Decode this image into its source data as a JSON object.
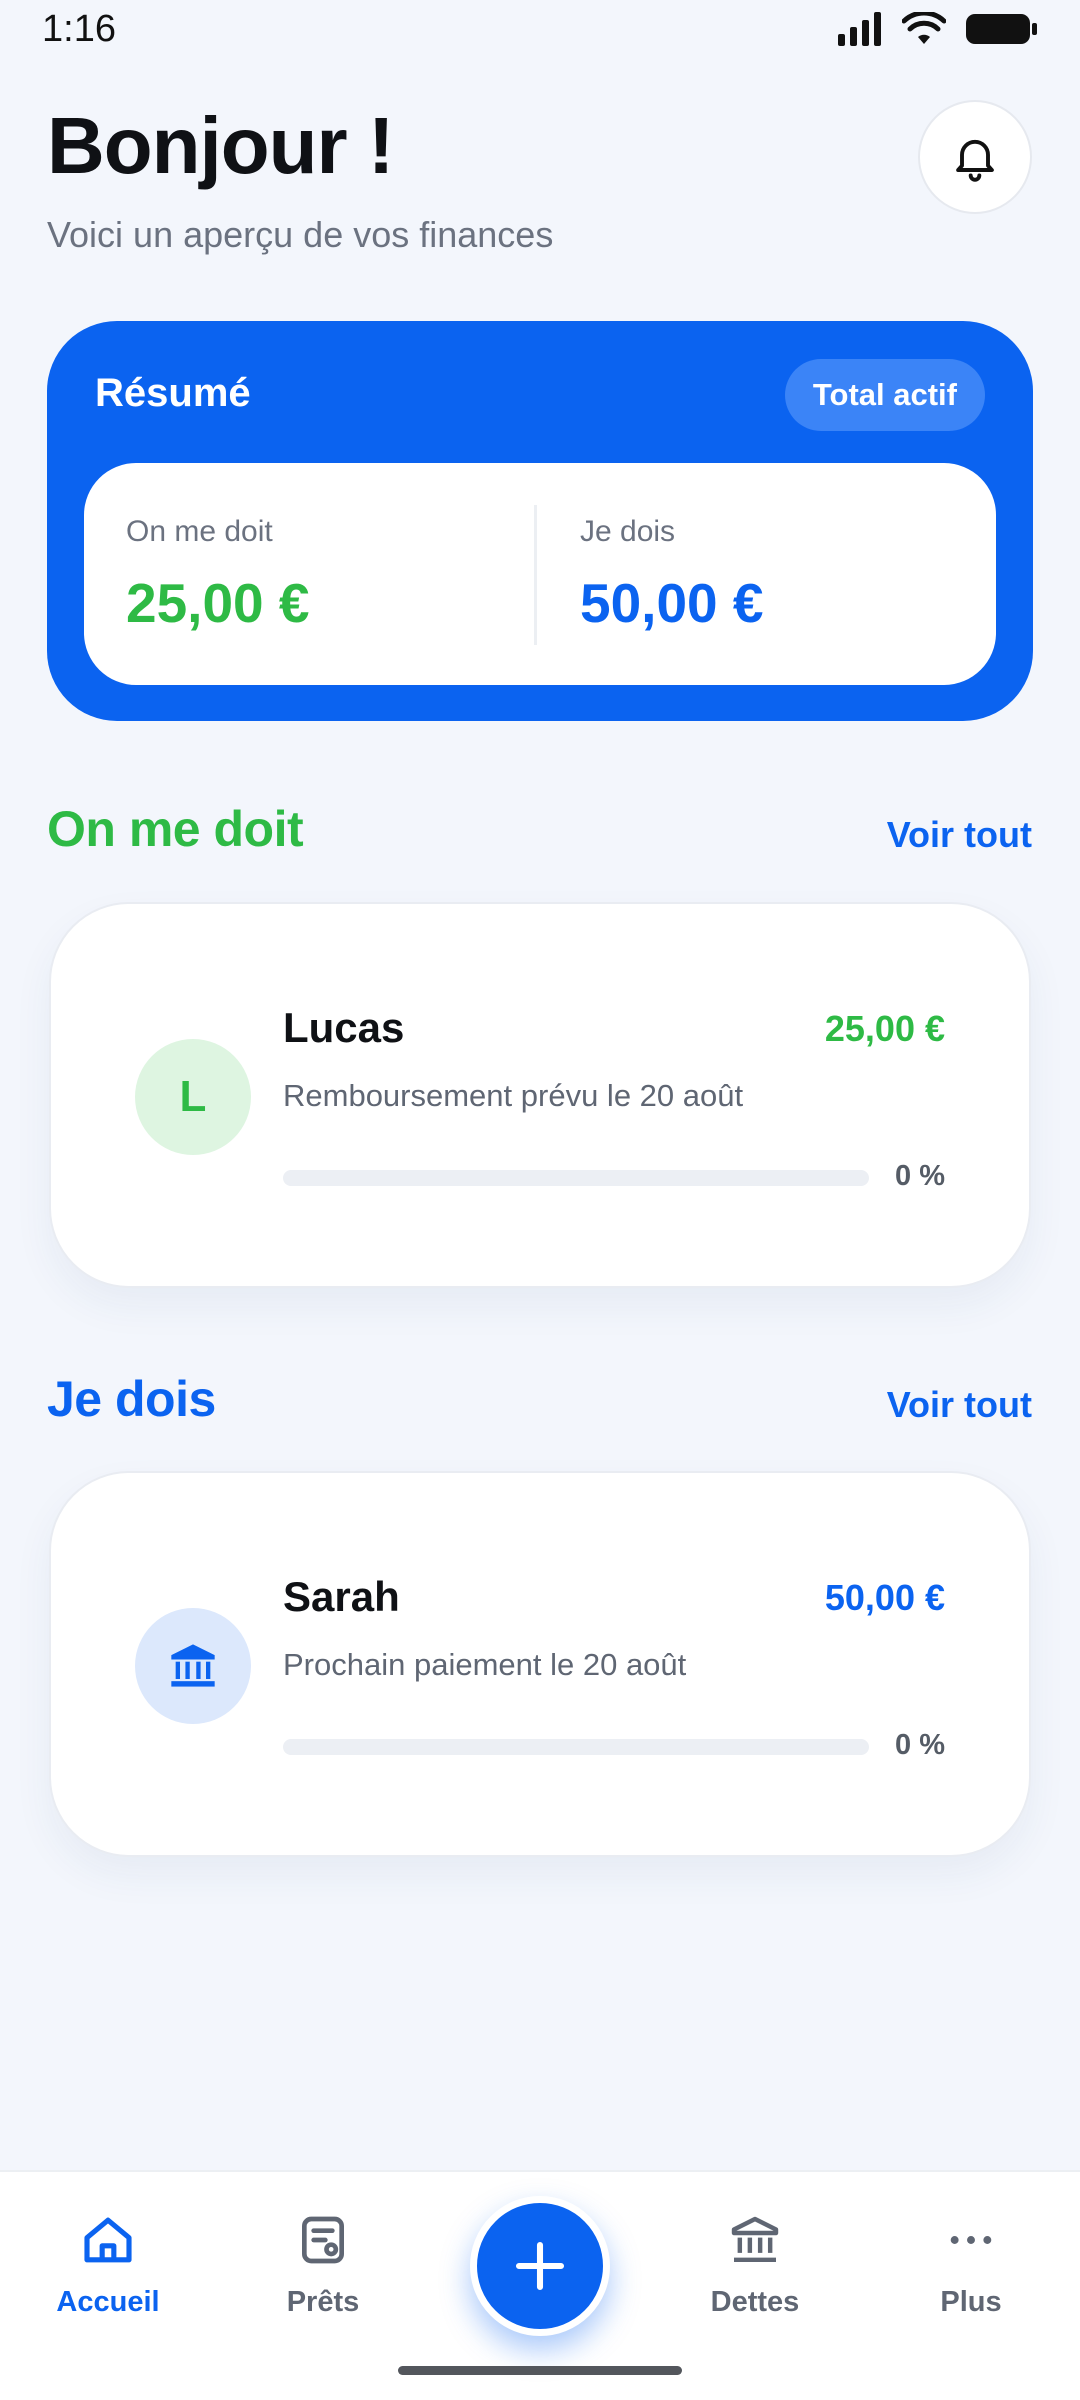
{
  "status_bar": {
    "time": "1:16"
  },
  "header": {
    "greeting": "Bonjour !",
    "subtitle": "Voici un aperçu de vos finances",
    "bell_icon": "bell-icon"
  },
  "summary": {
    "title": "Résumé",
    "pill": "Total actif",
    "owed_to_me_label": "On me doit",
    "owed_to_me_value": "25,00 €",
    "i_owe_label": "Je dois",
    "i_owe_value": "50,00 €"
  },
  "owed_section": {
    "title": "On me doit",
    "see_all": "Voir tout",
    "items": [
      {
        "avatar": "L",
        "name": "Lucas",
        "amount": "25,00 €",
        "description": "Remboursement prévu le 20 août",
        "progress": 0,
        "progress_label": "0 %"
      }
    ]
  },
  "debt_section": {
    "title": "Je dois",
    "see_all": "Voir tout",
    "items": [
      {
        "avatar_icon": "bank-icon",
        "name": "Sarah",
        "amount": "50,00 €",
        "description": "Prochain paiement le 20 août",
        "progress": 0,
        "progress_label": "0 %"
      }
    ]
  },
  "bottom_nav": {
    "items": [
      {
        "label": "Accueil",
        "icon": "home-icon",
        "active": true
      },
      {
        "label": "Prêts",
        "icon": "document-icon",
        "active": false
      },
      {
        "label": "Dettes",
        "icon": "bank-icon",
        "active": false
      },
      {
        "label": "Plus",
        "icon": "more-icon",
        "active": false
      }
    ],
    "fab_icon": "plus-icon"
  },
  "colors": {
    "primary": "#0b63f0",
    "positive": "#2eba45",
    "background": "#f3f6fc"
  }
}
